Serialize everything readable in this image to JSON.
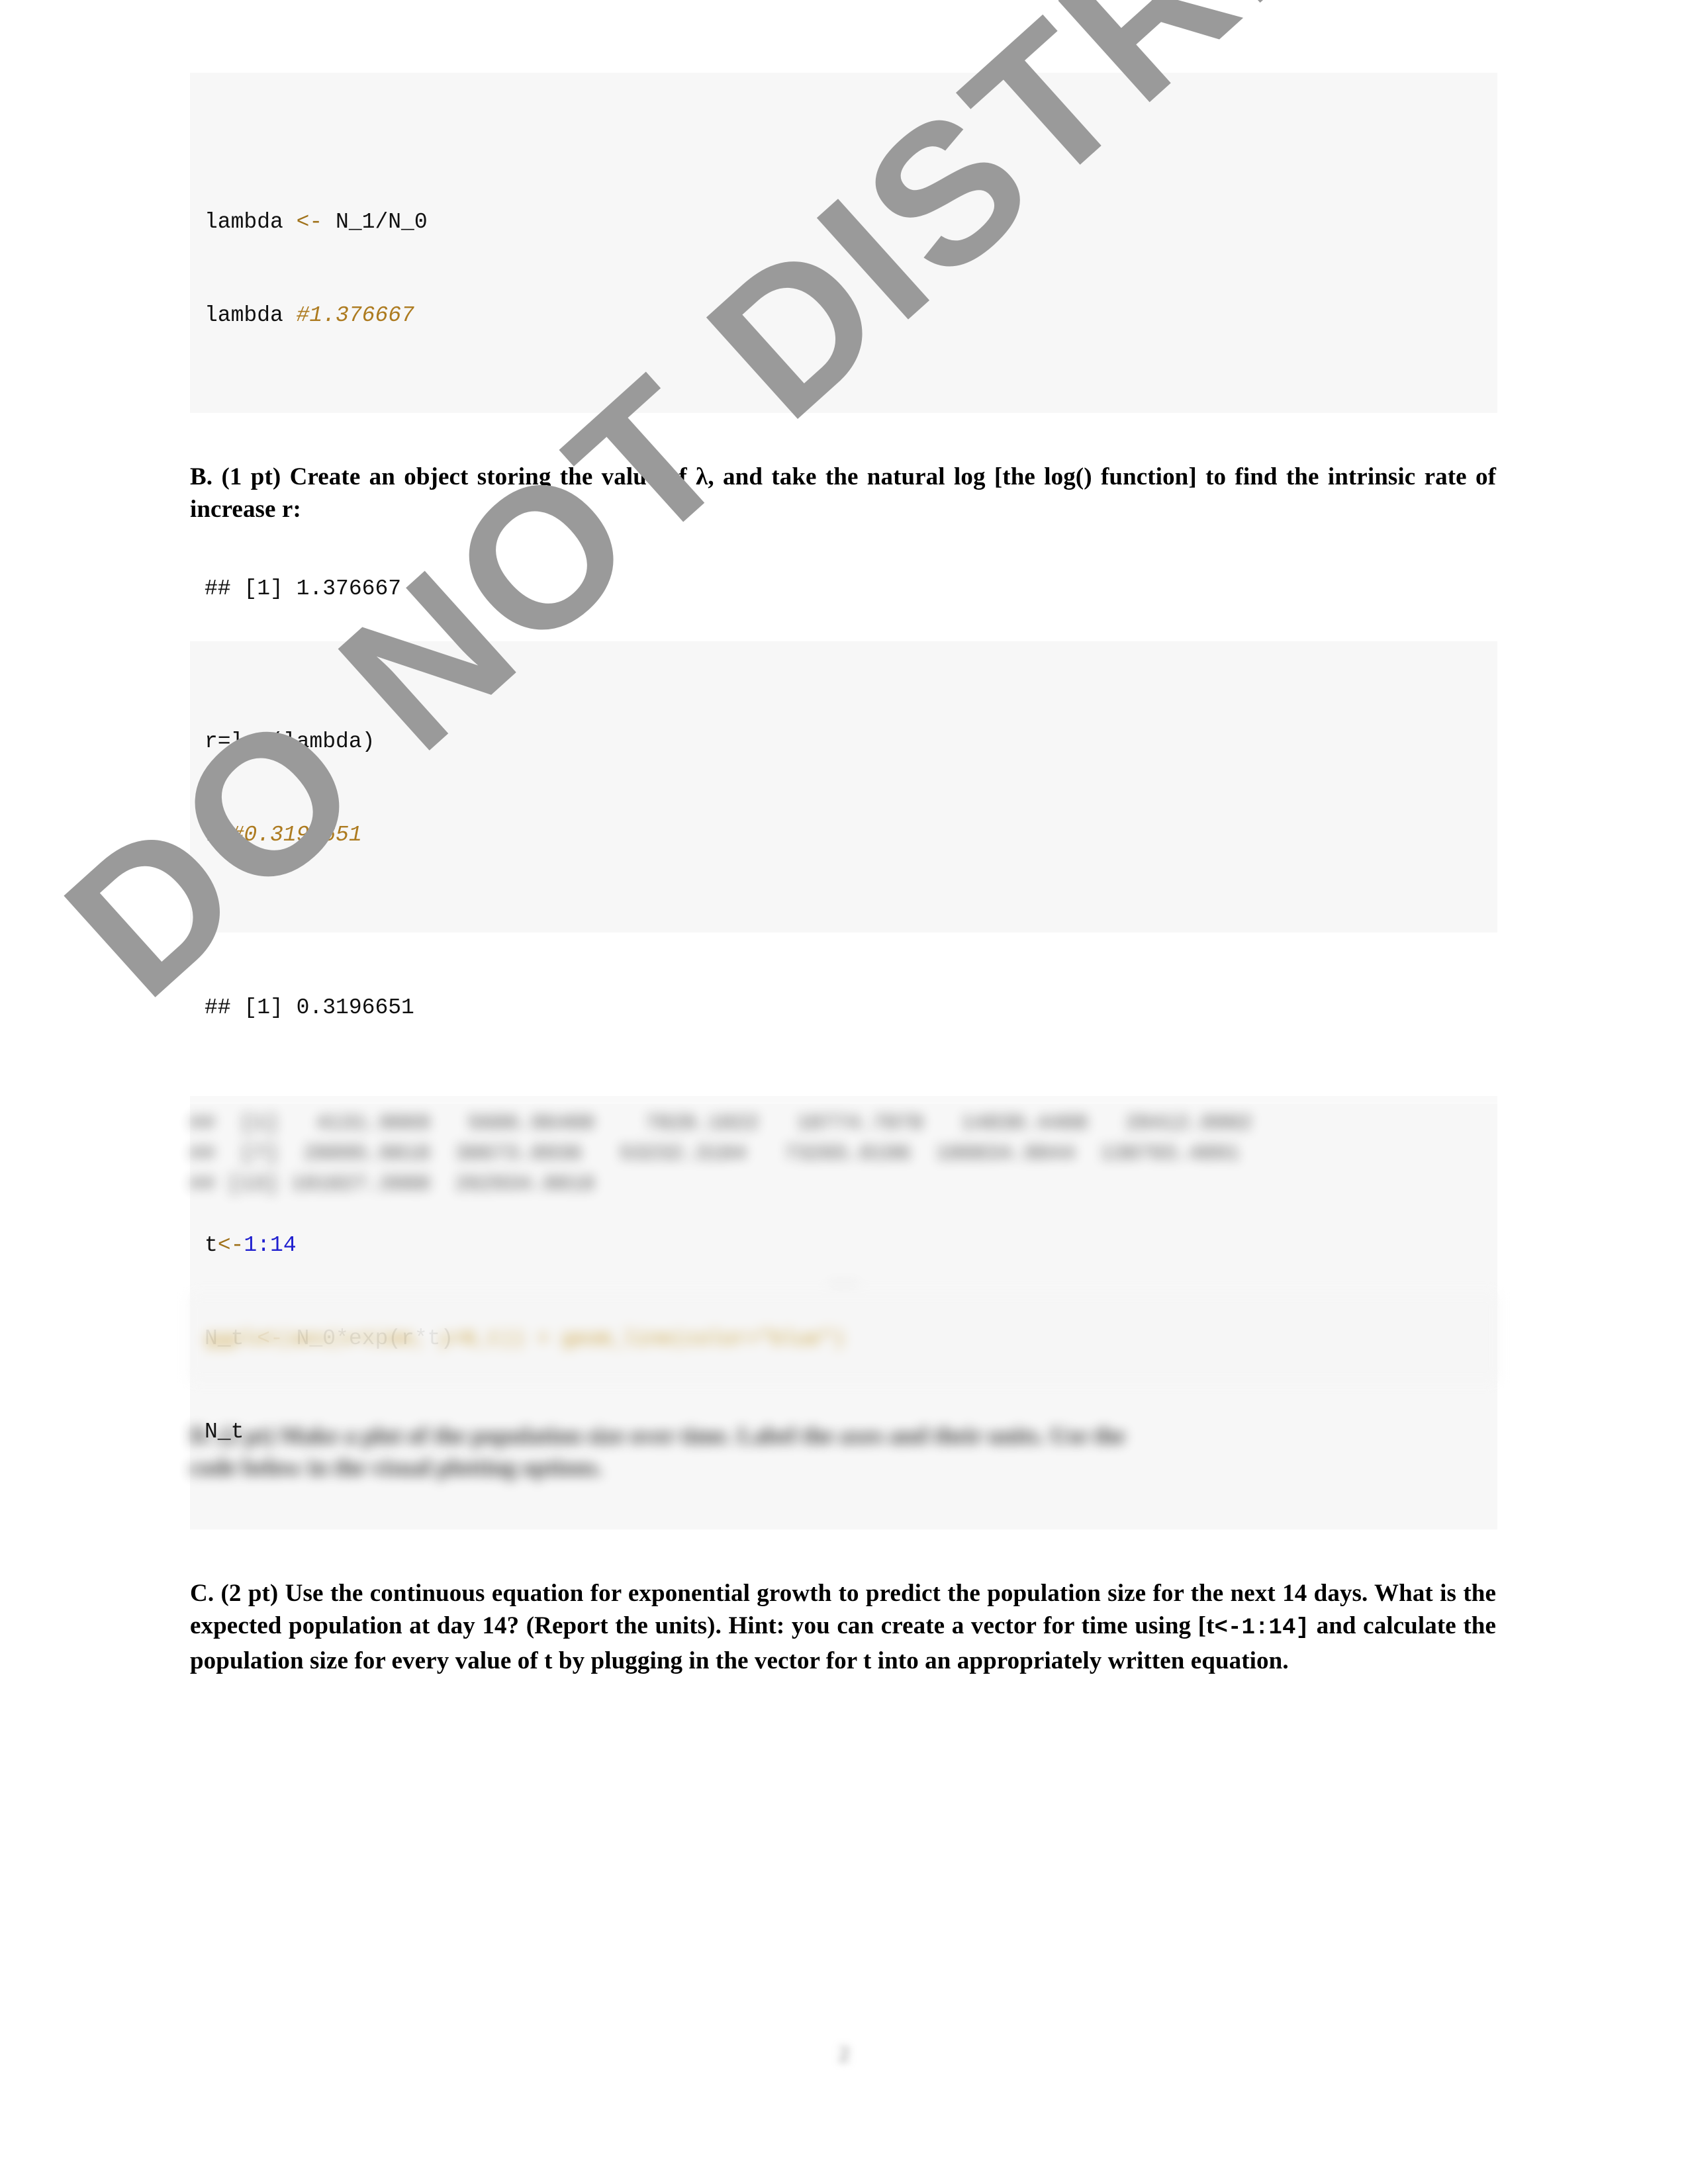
{
  "document": {
    "watermark_text": "DO NOT DISTRIBUTE",
    "watermark_color": "#9a9a9a",
    "page_number": "2",
    "page_background": "#ffffff",
    "code_background": "#f7f7f7"
  },
  "colors": {
    "assignment_arrow": "#a0721a",
    "comment": "#ad7b20",
    "number_literal": "#2020cf",
    "code_text": "#111111",
    "string_literal": "#3f9950"
  },
  "blocks": {
    "code1": {
      "line1_a": "lambda ",
      "line1_arrow": "<-",
      "line1_b": " N_1/N_0",
      "line2_a": "lambda ",
      "line2_comment": "#1.376667"
    },
    "paragraph_b": "B. (1 pt) Create an object storing the value of λ, and take the natural log [the log() function] to find the intrinsic rate of increase r:",
    "output1": "## [1] 1.376667",
    "code2": {
      "line1": "r=log(lambda)",
      "line2_a": "r ",
      "line2_comment": "#0.3196651"
    },
    "output2": "## [1] 0.3196651",
    "code3": {
      "line1_a": "t",
      "line1_arrow": "<-",
      "line1_num": "1:14",
      "line2_a": "N_t ",
      "line2_arrow": "<-",
      "line2_b": " N_0*exp(r*t)",
      "line3": "N_t"
    },
    "paragraph_c_part1": "C. (2 pt) Use the continuous equation for exponential growth to predict the population size for the next 14 days. What is the expected population at day 14? (Report the units). Hint: you can create a vector for time using [t",
    "paragraph_c_mono": "<-1:14]",
    "paragraph_c_part2": " and calculate the population size for every value of t by plugging in the vector for t into an appropriately written equation."
  },
  "redacted": {
    "note": "lower portion of page is blurred / unreadable",
    "output3_line1": "##  [1]   4131.9069   5686.96400    7828.1022   10774.7078   14830.4408   20412.0902",
    "output3_line2": "##  [7]  28095.9818  38673.8936   53232.3104   73265.0196  100834.9044  138793.4891",
    "output3_line3": "## [13] 191027.3988  262934.0018",
    "code4_line": "ggplot(aes(x=time, y=N_t)) + geom_line(color=\"blue\")",
    "paragraph_d_line1": "D. (2 pt) Make a plot of the population size over time. Label the axes and their units. Use the",
    "paragraph_d_line2": "code below in the visual plotting options."
  }
}
